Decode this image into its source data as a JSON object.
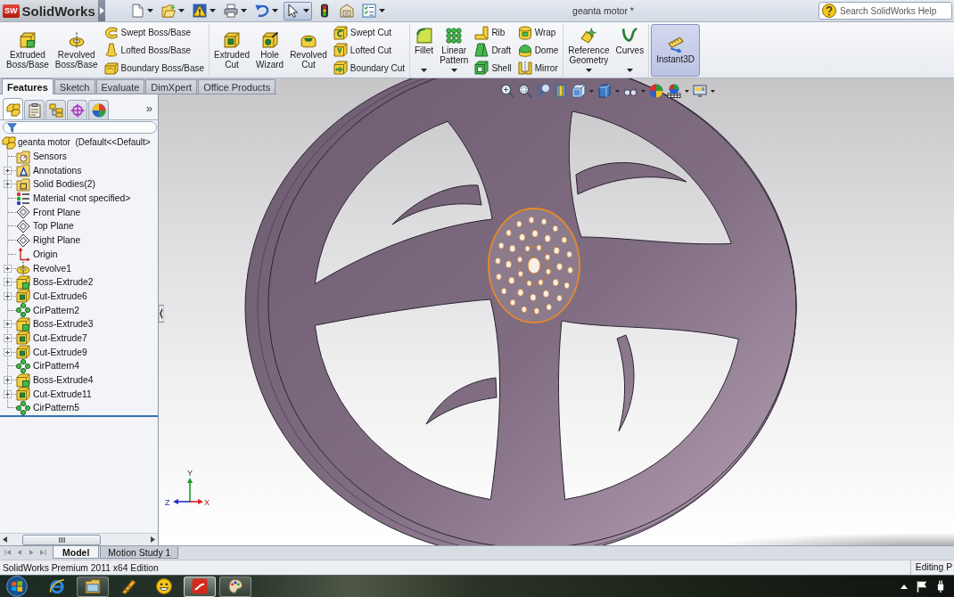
{
  "title_bar": {
    "logo_mark": "SW",
    "logo_text": "SolidWorks",
    "title": "geanta motor *",
    "search": {
      "placeholder": "Search SolidWorks Help"
    }
  },
  "quick_access": [
    {
      "dropdown": true,
      "selected": false
    },
    {
      "dropdown": true,
      "selected": false
    },
    {
      "dropdown": true,
      "selected": false
    },
    {
      "dropdown": true,
      "selected": false
    },
    {
      "dropdown": true,
      "selected": false
    },
    {
      "dropdown": true,
      "selected": true
    },
    {
      "dropdown": false,
      "selected": false
    },
    {
      "dropdown": false,
      "selected": false
    },
    {
      "dropdown": true,
      "selected": false
    }
  ],
  "ribbon": {
    "groups": [
      {
        "large": [
          {
            "label": "Extruded Boss/Base",
            "dropdown": false,
            "pressed": false
          },
          {
            "label": "Revolved Boss/Base",
            "dropdown": false,
            "pressed": false
          }
        ],
        "columns": [
          [
            "Swept Boss/Base",
            "Lofted Boss/Base",
            "Boundary Boss/Base"
          ]
        ]
      },
      {
        "large": [
          {
            "label": "Extruded Cut",
            "dropdown": false,
            "pressed": false
          },
          {
            "label": "Hole Wizard",
            "dropdown": false,
            "pressed": false
          },
          {
            "label": "Revolved Cut",
            "dropdown": false,
            "pressed": false
          }
        ],
        "columns": [
          [
            "Swept Cut",
            "Lofted Cut",
            "Boundary Cut"
          ]
        ]
      },
      {
        "large": [
          {
            "label": "Fillet",
            "dropdown": true,
            "pressed": false
          },
          {
            "label": "Linear Pattern",
            "dropdown": true,
            "pressed": false
          }
        ],
        "columns": [
          [
            "Rib",
            "Draft",
            "Shell"
          ],
          [
            "Wrap",
            "Dome",
            "Mirror"
          ]
        ]
      },
      {
        "large": [
          {
            "label": "Reference Geometry",
            "dropdown": true,
            "pressed": false
          },
          {
            "label": "Curves",
            "dropdown": true,
            "pressed": false
          }
        ]
      },
      {
        "large": [
          {
            "label": "Instant3D",
            "dropdown": false,
            "pressed": true
          }
        ]
      }
    ]
  },
  "command_tabs": [
    {
      "label": "Features",
      "selected": true
    },
    {
      "label": "Sketch",
      "selected": false
    },
    {
      "label": "Evaluate",
      "selected": false
    },
    {
      "label": "DimXpert",
      "selected": false
    },
    {
      "label": "Office Products",
      "selected": false
    }
  ],
  "feature_manager": {
    "tabs": [
      {
        "selected": true
      },
      {
        "selected": false
      },
      {
        "selected": false
      },
      {
        "selected": false
      },
      {
        "selected": false
      }
    ],
    "more": "»",
    "tree": {
      "label": "geanta motor  (Default<<Default>",
      "kind": "part",
      "children": [
        {
          "label": "Sensors",
          "kind": "sensors",
          "expandable": false
        },
        {
          "label": "Annotations",
          "kind": "annotations",
          "expandable": true
        },
        {
          "label": "Solid Bodies(2)",
          "kind": "bodies",
          "expandable": true
        },
        {
          "label": "Material <not specified>",
          "kind": "material",
          "expandable": false
        },
        {
          "label": "Front Plane",
          "kind": "plane",
          "expandable": false
        },
        {
          "label": "Top Plane",
          "kind": "plane",
          "expandable": false
        },
        {
          "label": "Right Plane",
          "kind": "plane",
          "expandable": false
        },
        {
          "label": "Origin",
          "kind": "origin",
          "expandable": false
        },
        {
          "label": "Revolve1",
          "kind": "revolve",
          "expandable": true
        },
        {
          "label": "Boss-Extrude2",
          "kind": "boss",
          "expandable": true
        },
        {
          "label": "Cut-Extrude6",
          "kind": "cut",
          "expandable": true
        },
        {
          "label": "CirPattern2",
          "kind": "pattern",
          "expandable": false
        },
        {
          "label": "Boss-Extrude3",
          "kind": "boss",
          "expandable": true
        },
        {
          "label": "Cut-Extrude7",
          "kind": "cut",
          "expandable": true
        },
        {
          "label": "Cut-Extrude9",
          "kind": "cut",
          "expandable": true
        },
        {
          "label": "CirPattern4",
          "kind": "pattern",
          "expandable": false
        },
        {
          "label": "Boss-Extrude4",
          "kind": "boss",
          "expandable": true
        },
        {
          "label": "Cut-Extrude11",
          "kind": "cut",
          "expandable": true
        },
        {
          "label": "CirPattern5",
          "kind": "pattern",
          "expandable": false
        }
      ]
    }
  },
  "axis_triad": {
    "y": "Y",
    "x": "X",
    "z": "Z"
  },
  "document_tabs": [
    {
      "label": "Model",
      "selected": true
    },
    {
      "label": "Motion Study 1",
      "selected": false
    }
  ],
  "status_bar": {
    "edition": "SolidWorks Premium 2011 x64 Edition",
    "mode": "Editing P"
  },
  "taskbar": [
    {
      "running": false,
      "selected": false
    },
    {
      "running": true,
      "selected": false
    },
    {
      "running": false,
      "selected": false
    },
    {
      "running": false,
      "selected": false
    },
    {
      "running": true,
      "selected": true
    },
    {
      "running": true,
      "selected": false
    }
  ]
}
